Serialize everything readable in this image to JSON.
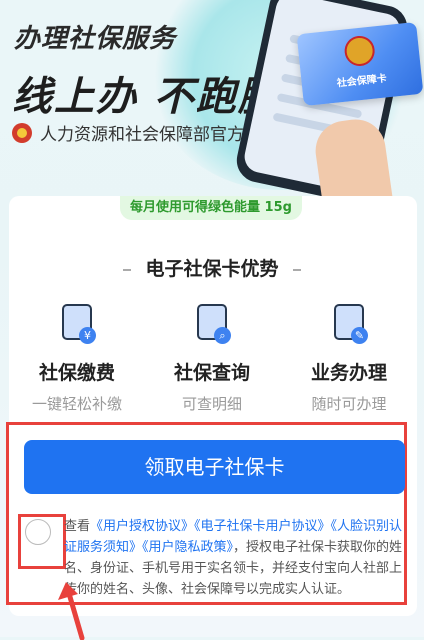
{
  "banner": {
    "headline1": "办理社保服务",
    "headline2": "线上办 不跑腿",
    "authority": "人力资源和社会保障部官方授权",
    "card_label": "社会保障卡"
  },
  "energy_tag": "每月使用可得绿色能量 15g",
  "advantages": {
    "title": "电子社保卡优势",
    "items": [
      {
        "name": "社保缴费",
        "desc": "一键轻松补缴",
        "icon": "yen-doc-icon"
      },
      {
        "name": "社保查询",
        "desc": "可查明细",
        "icon": "search-doc-icon"
      },
      {
        "name": "业务办理",
        "desc": "随时可办理",
        "icon": "edit-doc-icon"
      }
    ]
  },
  "cta_label": "领取电子社保卡",
  "agreement": {
    "prefix": "查看",
    "links": [
      "《用户授权协议》",
      "《电子社保卡用户协议》",
      "《人脸识别认证服务须知》",
      "《用户隐私政策》"
    ],
    "suffix": "，授权电子社保卡获取你的姓名、身份证、手机号用于实名领卡，并经支付宝向人社部上传你的姓名、头像、社会保障号以完成实人认证。"
  },
  "colors": {
    "primary": "#1f73f1",
    "energy_text": "#2e9a2e",
    "highlight": "#e8413c"
  }
}
